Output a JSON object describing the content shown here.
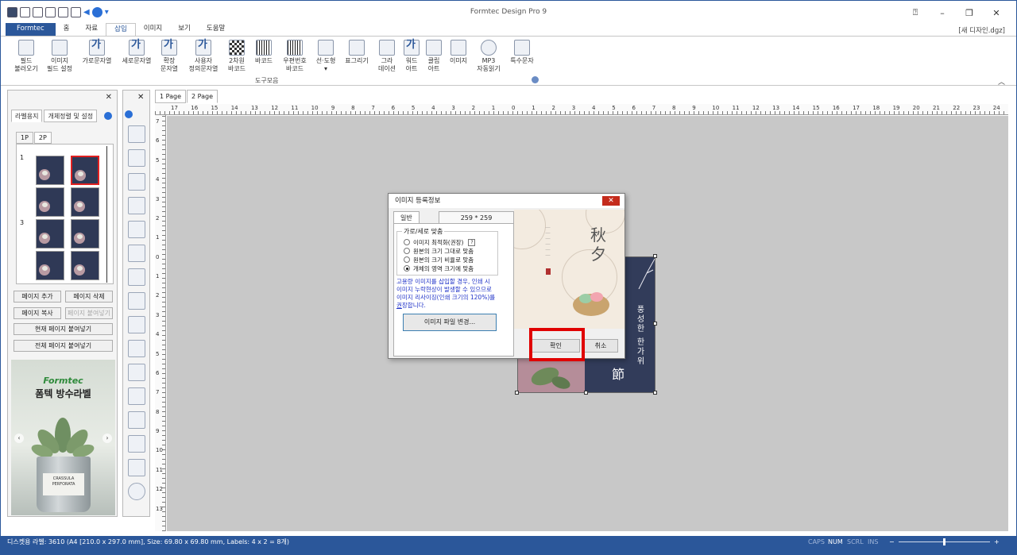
{
  "window": {
    "title": "Formtec Design Pro 9",
    "document_name": "[새 디자인.dgz]"
  },
  "menu_tabs": [
    {
      "label": "Formtec",
      "active": false,
      "brand": true
    },
    {
      "label": "홈",
      "active": false
    },
    {
      "label": "자료",
      "active": false
    },
    {
      "label": "삽입",
      "active": true
    },
    {
      "label": "이미지",
      "active": false
    },
    {
      "label": "보기",
      "active": false
    },
    {
      "label": "도움말",
      "active": false
    }
  ],
  "ribbon": {
    "buttons": [
      {
        "label": "필드\n불러오기",
        "icon": "field-load-icon"
      },
      {
        "label": "이미지\n필드 설정",
        "icon": "image-field-icon"
      },
      {
        "label": "가로문자열",
        "icon": "horizontal-text-icon"
      },
      {
        "label": "세로문자열",
        "icon": "vertical-text-icon"
      },
      {
        "label": "확장\n문자열",
        "icon": "extended-text-icon"
      },
      {
        "label": "사용자\n정의문자열",
        "icon": "custom-text-icon"
      },
      {
        "label": "2차원\n바코드",
        "icon": "qr-code-icon"
      },
      {
        "label": "바코드",
        "icon": "barcode-icon"
      },
      {
        "label": "우편번호\n바코드",
        "icon": "postal-barcode-icon"
      },
      {
        "label": "선·도형",
        "icon": "shape-icon"
      },
      {
        "label": "표그리기",
        "icon": "table-icon"
      },
      {
        "label": "그라\n데이션",
        "icon": "gradient-icon"
      },
      {
        "label": "워드\n아트",
        "icon": "word-art-icon"
      },
      {
        "label": "클립\n아트",
        "icon": "clip-art-icon"
      },
      {
        "label": "이미지",
        "icon": "image-icon"
      },
      {
        "label": "MP3\n자동읽기",
        "icon": "mp3-icon"
      },
      {
        "label": "특수문자",
        "icon": "special-char-icon"
      }
    ],
    "group_label": "도구모음"
  },
  "left_panel": {
    "tabs": [
      "라벨용지",
      "개체정렬 및 설정"
    ],
    "page_tabs": [
      "1P",
      "2P"
    ],
    "row_numbers": [
      "1",
      "3"
    ],
    "buttons": {
      "add_page": "페이지 추가",
      "delete_page": "페이지 삭제",
      "copy_page": "페이지 복사",
      "paste_page": "페이지 붙여넣기",
      "paste_current": "현재 페이지 붙여넣기",
      "paste_all": "전체 페이지 붙여넣기"
    },
    "ad": {
      "brand": "Formtec",
      "title": "폼텍 방수라벨",
      "pot_label": "CRASSULA\nPERFORATA"
    }
  },
  "doc_tabs": [
    {
      "label": "1 Page",
      "active": false
    },
    {
      "label": "2 Page",
      "active": true
    }
  ],
  "ruler": {
    "h_numbers": [
      "17",
      "16",
      "15",
      "14",
      "13",
      "12",
      "11",
      "10",
      "9",
      "8",
      "7",
      "6",
      "5",
      "4",
      "3",
      "2",
      "1",
      "0",
      "1",
      "2",
      "3",
      "4",
      "5",
      "6",
      "7",
      "8",
      "9",
      "10",
      "11",
      "12",
      "13",
      "14",
      "15",
      "16",
      "17",
      "18",
      "19",
      "20",
      "21",
      "22",
      "23",
      "24"
    ],
    "v_numbers": [
      "7",
      "6",
      "5",
      "4",
      "3",
      "2",
      "1",
      "0",
      "1",
      "2",
      "3",
      "4",
      "5",
      "6",
      "7",
      "8",
      "9",
      "10",
      "11",
      "12",
      "13"
    ]
  },
  "label_object": {
    "vertical_text": "풍성한 한가위",
    "char": "節"
  },
  "dialog": {
    "title": "이미지 등록정보",
    "tab": "일반",
    "size": "259 * 259",
    "fit_group_title": "가로/세로 맞춤",
    "options": [
      {
        "label": "이미지 최적화(권장)",
        "checked": false
      },
      {
        "label": "원본의 크기 그대로 맞춤",
        "checked": false
      },
      {
        "label": "원본의 크기 비율로 맞춤",
        "checked": false
      },
      {
        "label": "개체의 영역 크기에 맞춤",
        "checked": true
      }
    ],
    "help": "?",
    "note_line1": "고용량 이미지를 삽입할 경우, 인쇄 시",
    "note_line2": "이미지 누락현상이 발생할 수 있으므로",
    "note_line3": "이미지 리사이징(인쇄 크기의 120%)를",
    "note_line4_u": "권",
    "note_line4_rest": "장합니다.",
    "change_file": "이미지 파일 변경...",
    "ok": "확인",
    "cancel": "취소",
    "preview_chars": "秋夕"
  },
  "status_bar": {
    "text": "디스켓용 라벨: 3610 (A4 [210.0 x 297.0 mm], Size: 69.80 x 69.80 mm,  Labels: 4 x 2 = 8개)",
    "caps": "CAPS",
    "num": "NUM",
    "scrl": "SCRL",
    "ins": "INS",
    "zoom_minus": "−",
    "zoom_plus": "+"
  },
  "colors": {
    "accent": "#2b579a",
    "highlight": "#e00000"
  }
}
